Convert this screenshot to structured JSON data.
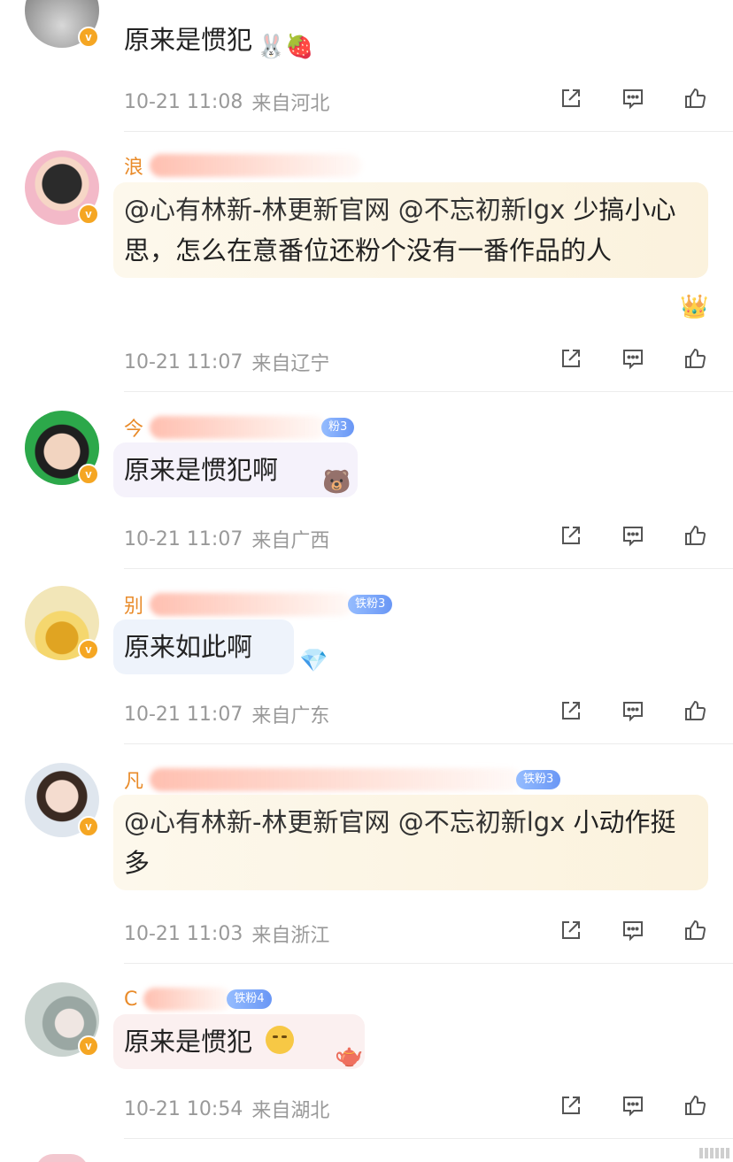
{
  "comments": [
    {
      "name": "",
      "text": "原来是惯犯",
      "time": "10-21 11:08",
      "location": "来自河北",
      "verified": "v"
    },
    {
      "name": "浪",
      "fan_badge": "",
      "mention1": "@心有林新-林更新官网",
      "mention2": "@不忘初新lgx",
      "text": "少搞小心思，怎么在意番位还粉个没有一番作品的人",
      "time": "10-21 11:07",
      "location": "来自辽宁",
      "verified": "v"
    },
    {
      "name": "今",
      "fan_badge": "粉3",
      "text": "原来是惯犯啊",
      "time": "10-21 11:07",
      "location": "来自广西",
      "verified": "v"
    },
    {
      "name": "别",
      "fan_badge": "铁粉3",
      "text": "原来如此啊",
      "time": "10-21 11:07",
      "location": "来自广东",
      "verified": "v"
    },
    {
      "name": "凡",
      "fan_badge": "铁粉3",
      "mention1": "@心有林新-林更新官网",
      "mention2": "@不忘初新lgx",
      "text": "小动作挺多",
      "time": "10-21 11:03",
      "location": "来自浙江",
      "verified": "v"
    },
    {
      "name": "C",
      "fan_badge": "铁粉4",
      "text": "原来是惯犯",
      "time": "10-21 10:54",
      "location": "来自湖北",
      "verified": "v"
    }
  ],
  "icons": {
    "share": "share-icon",
    "comment": "comment-icon",
    "like": "like-icon"
  },
  "colors": {
    "username": "#e98b2a",
    "meta": "#999999",
    "verified": "#f5a623"
  }
}
